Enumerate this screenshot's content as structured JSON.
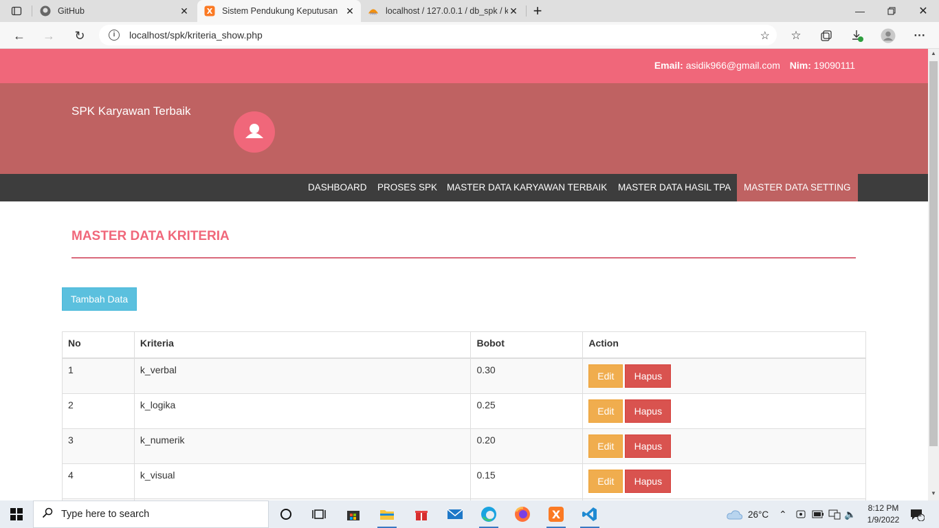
{
  "browser": {
    "tabs": [
      {
        "title": "GitHub",
        "active": false
      },
      {
        "title": "Sistem Pendukung Keputusan",
        "active": true
      },
      {
        "title": "localhost / 127.0.0.1 / db_spk / k",
        "active": false
      }
    ],
    "url": "localhost/spk/kriteria_show.php"
  },
  "topbar": {
    "email_label": "Email:",
    "email_value": "asidik966@gmail.com",
    "nim_label": "Nim:",
    "nim_value": "19090111"
  },
  "header": {
    "brand": "SPK Karyawan Terbaik"
  },
  "nav": {
    "items": [
      {
        "label": "DASHBOARD"
      },
      {
        "label": "PROSES SPK"
      },
      {
        "label": "MASTER DATA KARYAWAN TERBAIK"
      },
      {
        "label": "MASTER DATA HASIL TPA"
      },
      {
        "label": "MASTER DATA SETTING",
        "active": true
      }
    ]
  },
  "main": {
    "title": "MASTER DATA KRITERIA",
    "add_button": "Tambah Data",
    "table": {
      "headers": [
        "No",
        "Kriteria",
        "Bobot",
        "Action"
      ],
      "rows": [
        {
          "no": "1",
          "kriteria": "k_verbal",
          "bobot": "0.30"
        },
        {
          "no": "2",
          "kriteria": "k_logika",
          "bobot": "0.25"
        },
        {
          "no": "3",
          "kriteria": "k_numerik",
          "bobot": "0.20"
        },
        {
          "no": "4",
          "kriteria": "k_visual",
          "bobot": "0.15"
        }
      ],
      "edit_label": "Edit",
      "delete_label": "Hapus"
    }
  },
  "taskbar": {
    "search_placeholder": "Type here to search",
    "temperature": "26°C",
    "time": "8:12 PM",
    "date": "1/9/2022",
    "notification_count": "1"
  },
  "colors": {
    "topbar": "#f0677a",
    "header": "#bf6262",
    "nav": "#3d3d3d",
    "accent": "#f0677a",
    "info_button": "#5bc0de",
    "warning_button": "#f0ad4e",
    "danger_button": "#d9534f"
  }
}
